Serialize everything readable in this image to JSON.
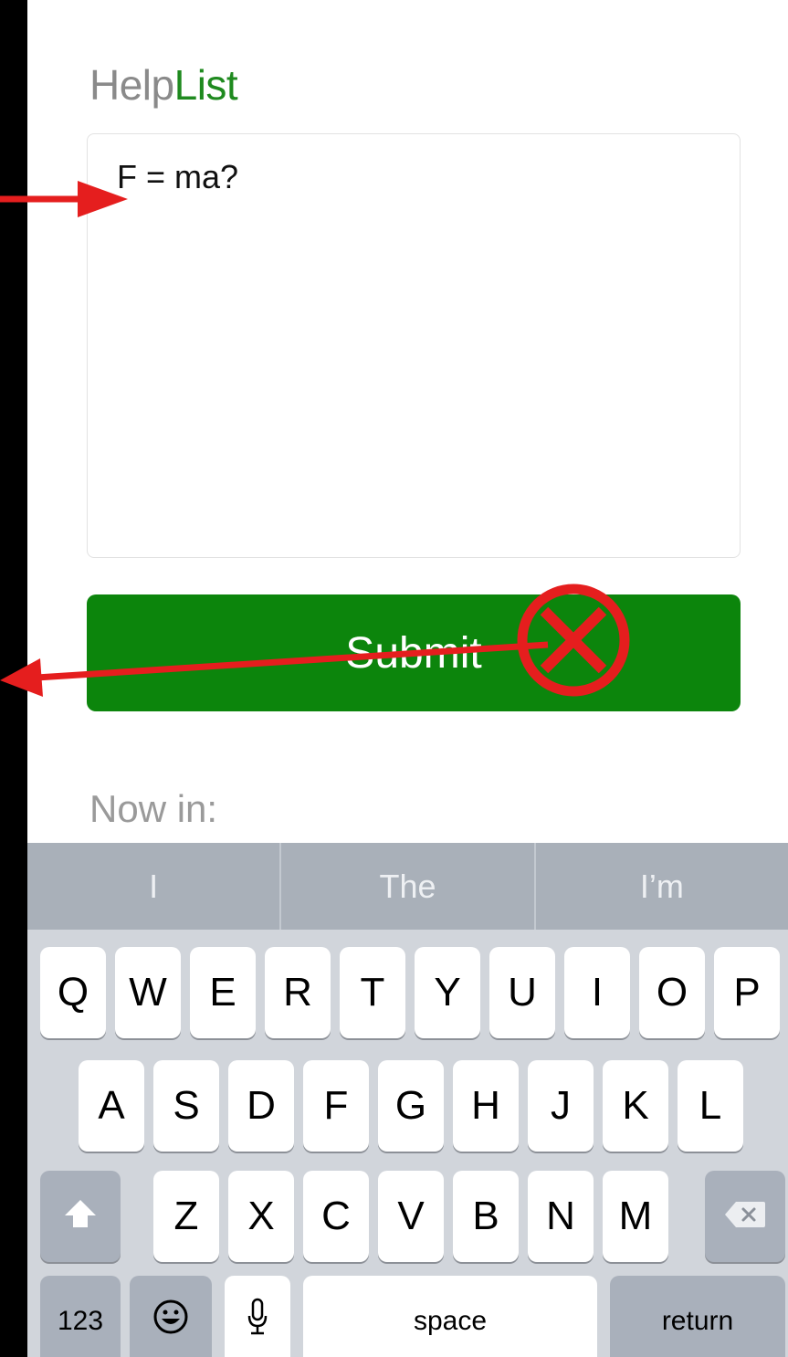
{
  "app": {
    "title_part1": "Help",
    "title_part2": "List",
    "accent_color": "#1f8a1f"
  },
  "question": {
    "value": "F = ma?"
  },
  "submit": {
    "label": "Submit",
    "color": "#0c850c"
  },
  "status": {
    "now_in_label": "Now in:"
  },
  "keyboard": {
    "suggestions": [
      "I",
      "The",
      "I’m"
    ],
    "row1": [
      "Q",
      "W",
      "E",
      "R",
      "T",
      "Y",
      "U",
      "I",
      "O",
      "P"
    ],
    "row2": [
      "A",
      "S",
      "D",
      "F",
      "G",
      "H",
      "J",
      "K",
      "L"
    ],
    "row3": [
      "Z",
      "X",
      "C",
      "V",
      "B",
      "N",
      "M"
    ],
    "numbers_label": "123",
    "space_label": "space",
    "return_label": "return",
    "icons": {
      "shift": "shift-icon",
      "delete": "backspace-icon",
      "emoji": "emoji-icon",
      "mic": "microphone-icon"
    }
  },
  "annotations": {
    "arrow_color": "#e51e1e",
    "blocked_symbol": "circle-x-icon"
  }
}
